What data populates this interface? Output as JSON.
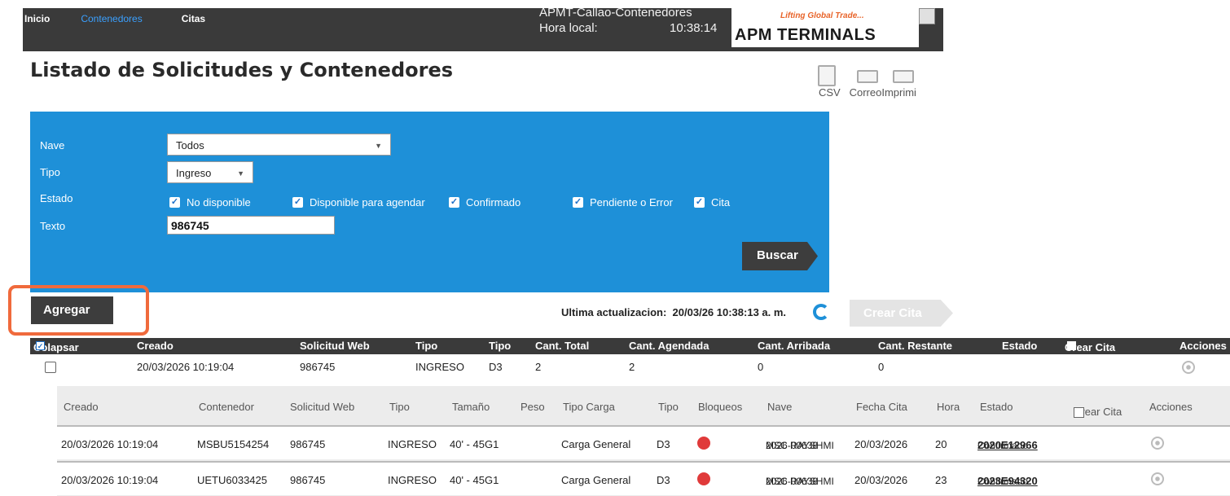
{
  "nav": {
    "inicio": "Inicio",
    "contenedores": "Contenedores",
    "citas": "Citas"
  },
  "site": {
    "name": "APMT-Callao-Contenedores",
    "hora_label": "Hora local:",
    "hora": "10:38:14"
  },
  "logo": {
    "tagline": "Lifting Global Trade...",
    "name": "APM TERMINALS"
  },
  "title": "Listado de Solicitudes y Contenedores",
  "export": {
    "csv": "CSV",
    "correo": "Correo",
    "imprimir": "Imprimi"
  },
  "filter": {
    "nave_label": "Nave",
    "nave_value": "Todos",
    "tipo_label": "Tipo",
    "tipo_value": "Ingreso",
    "estado_label": "Estado",
    "estados": [
      "No disponible",
      "Disponible para agendar",
      "Confirmado",
      "Pendiente o Error",
      "Cita"
    ],
    "texto_label": "Texto",
    "texto_value": "986745",
    "buscar": "Buscar"
  },
  "actions": {
    "agregar": "Agregar",
    "update_label": "Ultima actualizacion:",
    "update_value": "20/03/26 10:38:13 a. m.",
    "crear_cita": "Crear Cita"
  },
  "main": {
    "headers": [
      "Colapsar",
      "Creado",
      "Solicitud Web",
      "Tipo",
      "Tipo",
      "Cant. Total",
      "Cant. Agendada",
      "Cant. Arribada",
      "Cant. Restante",
      "Estado",
      "Crear Cita",
      "Acciones"
    ],
    "row": {
      "creado": "20/03/2026 10:19:04",
      "solicitud": "986745",
      "tipo": "INGRESO",
      "tipo2": "D3",
      "total": "2",
      "agendada": "2",
      "arribada": "0",
      "restante": "0"
    }
  },
  "sub": {
    "headers": [
      "Creado",
      "Contenedor",
      "Solicitud Web",
      "Tipo",
      "Tamaño",
      "Peso",
      "Tipo Carga",
      "Tipo",
      "Bloqueos",
      "Nave",
      "Fecha Cita",
      "Hora",
      "Estado",
      "Crear Cita",
      "Acciones"
    ],
    "rows": [
      {
        "creado": "20/03/2026 10:19:04",
        "contenedor": "MSBU5154254",
        "solicitud": "986745",
        "tipo": "INGRESO",
        "tamano": "40' - 45G1",
        "carga": "Carga General",
        "tipo2": "D3",
        "nave1": "MSC RAYSHMI",
        "nave2": "2026-00638",
        "fecha": "20/03/2026",
        "hora": "20",
        "estado": "Confirmado",
        "codigo": "2020E12966"
      },
      {
        "creado": "20/03/2026 10:19:04",
        "contenedor": "UETU6033425",
        "solicitud": "986745",
        "tipo": "INGRESO",
        "tamano": "40' - 45G1",
        "carga": "Carga General",
        "tipo2": "D3",
        "nave1": "MSC RAYSHMI",
        "nave2": "2026-00638",
        "fecha": "20/03/2026",
        "hora": "23",
        "estado": "Confirmado",
        "codigo": "2023E94320"
      }
    ]
  },
  "colors": {
    "accent": "#1e90d8",
    "dark": "#3a3a3a",
    "highlight": "#f06a3c",
    "blocked": "#e03a3a"
  }
}
